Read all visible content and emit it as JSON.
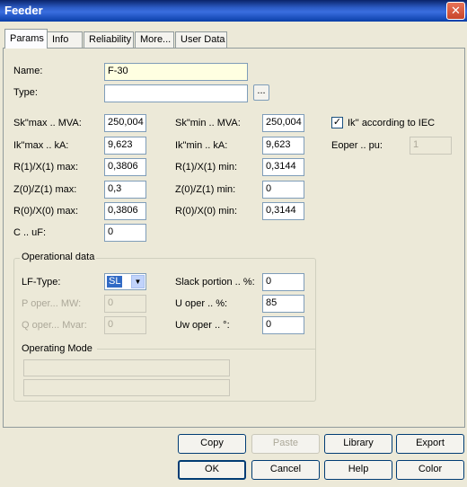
{
  "window": {
    "title": "Feeder",
    "close_glyph": "✕"
  },
  "tabs": [
    {
      "label": "Params",
      "active": true
    },
    {
      "label": "Info"
    },
    {
      "label": "Reliability"
    },
    {
      "label": "More..."
    },
    {
      "label": "User Data"
    }
  ],
  "params": {
    "name_label": "Name:",
    "name_value": "F-30",
    "type_label": "Type:",
    "type_value": "",
    "type_button": "...",
    "sk_max_label": "Sk\"max .. MVA:",
    "sk_max_value": "250,004",
    "ik_max_label": "Ik\"max .. kA:",
    "ik_max_value": "9,623",
    "r1x1_max_label": "R(1)/X(1) max:",
    "r1x1_max_value": "0,3806",
    "z0z1_max_label": "Z(0)/Z(1) max:",
    "z0z1_max_value": "0,3",
    "r0x0_max_label": "R(0)/X(0) max:",
    "r0x0_max_value": "0,3806",
    "c_label": "C .. uF:",
    "c_value": "0",
    "sk_min_label": "Sk\"min .. MVA:",
    "sk_min_value": "250,004",
    "ik_min_label": "Ik\"min .. kA:",
    "ik_min_value": "9,623",
    "r1x1_min_label": "R(1)/X(1) min:",
    "r1x1_min_value": "0,3144",
    "z0z1_min_label": "Z(0)/Z(1) min:",
    "z0z1_min_value": "0",
    "r0x0_min_label": "R(0)/X(0) min:",
    "r0x0_min_value": "0,3144",
    "iec_label": "Ik'' according to IEC",
    "iec_checked": true,
    "check_glyph": "✓",
    "eoper_label": "Eoper .. pu:",
    "eoper_value": "1"
  },
  "operational": {
    "title": "Operational data",
    "lf_type_label": "LF-Type:",
    "lf_type_value": "SL",
    "arrow_glyph": "▼",
    "p_oper_label": "P oper... MW:",
    "p_oper_value": "0",
    "q_oper_label": "Q oper... Mvar:",
    "q_oper_value": "0",
    "slack_label": "Slack portion .. %:",
    "slack_value": "0",
    "u_oper_label": "U oper .. %:",
    "u_oper_value": "85",
    "uw_oper_label": "Uw oper .. °:",
    "uw_oper_value": "0",
    "mode_title": "Operating Mode"
  },
  "buttons": {
    "copy": "Copy",
    "paste": "Paste",
    "library": "Library",
    "export": "Export",
    "ok": "OK",
    "cancel": "Cancel",
    "help": "Help",
    "color": "Color"
  }
}
